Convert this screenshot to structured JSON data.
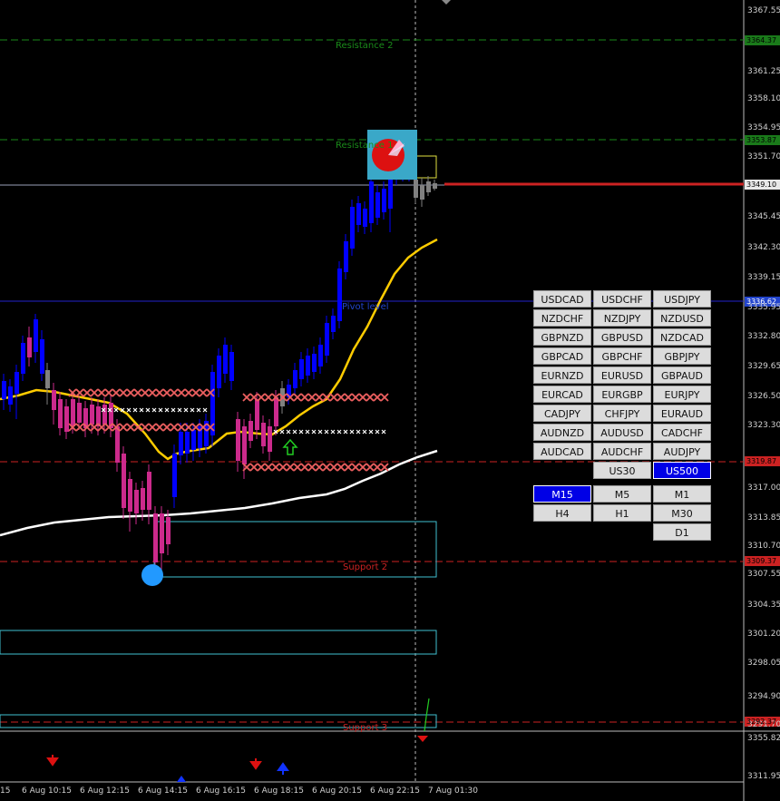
{
  "price_axis": {
    "ticks": [
      "3367.55",
      "3361.25",
      "3358.10",
      "3354.95",
      "3351.70",
      "3345.45",
      "3342.30",
      "3339.15",
      "3335.95",
      "3332.80",
      "3329.65",
      "3326.50",
      "3323.30",
      "3317.00",
      "3313.85",
      "3310.70",
      "3307.55",
      "3304.35",
      "3301.20",
      "3298.05",
      "3294.90",
      "3291.70"
    ],
    "badges": {
      "resistance2": "3364.37",
      "resistance1": "3353.87",
      "current": "3349.10",
      "pivot": "3336.62",
      "support1": "3319.87",
      "support2": "3309.37",
      "support3": "3292.37"
    }
  },
  "sub_axis": {
    "ticks": [
      "3355.82",
      "3311.95"
    ]
  },
  "time_axis": {
    "labels": [
      "15",
      "6 Aug 10:15",
      "6 Aug 12:15",
      "6 Aug 14:15",
      "6 Aug 16:15",
      "6 Aug 18:15",
      "6 Aug 20:15",
      "6 Aug 22:15",
      "7 Aug 01:30"
    ]
  },
  "levels": {
    "resistance2": "Resistance 2",
    "resistance1": "Resistance 1",
    "pivot": "Pivot level",
    "support2": "Support 2",
    "support3": "Support 3"
  },
  "symbols": {
    "rows": [
      [
        "USDCAD",
        "USDCHF",
        "USDJPY"
      ],
      [
        "NZDCHF",
        "NZDJPY",
        "NZDUSD"
      ],
      [
        "GBPNZD",
        "GBPUSD",
        "NZDCAD"
      ],
      [
        "GBPCAD",
        "GBPCHF",
        "GBPJPY"
      ],
      [
        "EURNZD",
        "EURUSD",
        "GBPAUD"
      ],
      [
        "EURCAD",
        "EURGBP",
        "EURJPY"
      ],
      [
        "CADJPY",
        "CHFJPY",
        "EURAUD"
      ],
      [
        "AUDNZD",
        "AUDUSD",
        "CADCHF"
      ],
      [
        "AUDCAD",
        "AUDCHF",
        "AUDJPY"
      ]
    ],
    "extra": [
      "US30",
      "US500"
    ],
    "active": "US500"
  },
  "timeframes": {
    "rows": [
      [
        "M15",
        "M5",
        "M1"
      ],
      [
        "H4",
        "H1",
        "M30"
      ],
      [
        "D1"
      ]
    ],
    "active": "M15"
  },
  "colors": {
    "bull": "#0000ff",
    "bear": "#cc2a8c",
    "neutral": "#808080",
    "ma_fast": "#ffcc00",
    "ma_slow": "#ffffff",
    "resistance": "#1a8a1a",
    "support": "#cc2222",
    "pivot": "#2222cc",
    "zone": "#40c0d0"
  },
  "icons": [
    "sell-arrow-icon",
    "buy-arrow-icon",
    "buy-signal-arrow-icon",
    "pie-indicator-icon"
  ]
}
